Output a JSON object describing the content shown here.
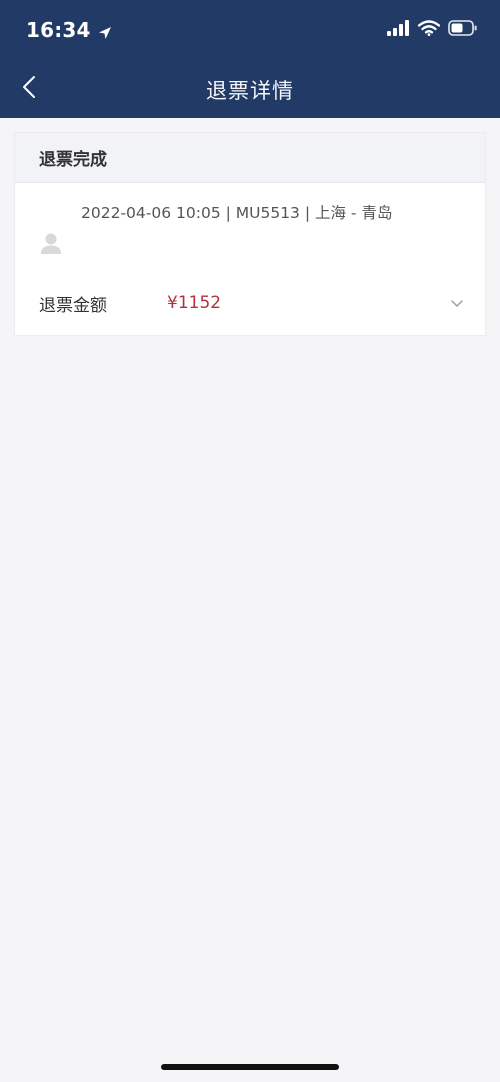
{
  "status_bar": {
    "time": "16:34"
  },
  "nav": {
    "title": "退票详情"
  },
  "refund_card": {
    "status": "退票完成",
    "flight_info": "2022-04-06 10:05 | MU5513 | 上海 - 青岛",
    "refund_label": "退票金额",
    "refund_amount": "¥1152"
  },
  "icons": {
    "location": "location-arrow-icon",
    "signal": "cellular-signal-icon",
    "wifi": "wifi-icon",
    "battery": "battery-icon",
    "back": "chevron-left-icon",
    "passenger": "user-icon",
    "expand": "chevron-down-icon"
  },
  "colors": {
    "header_bg": "#223a66",
    "amount": "#b3313f",
    "page_bg": "#f5f5f7"
  }
}
